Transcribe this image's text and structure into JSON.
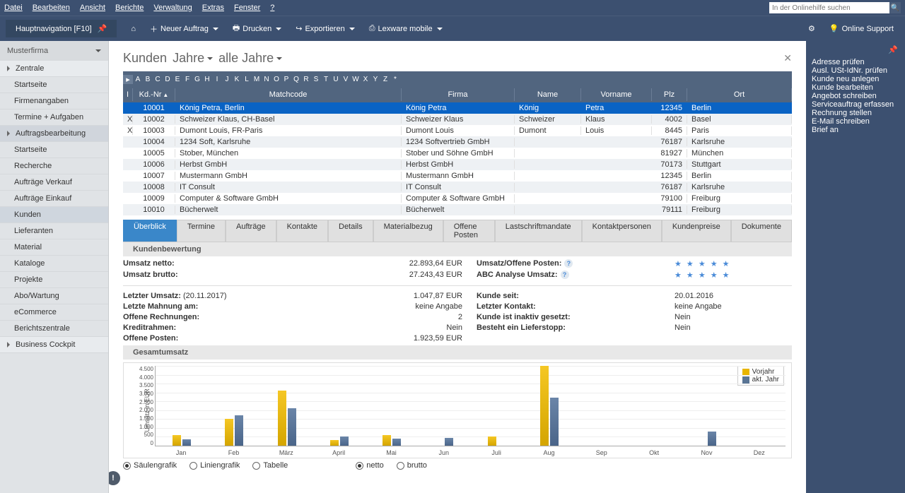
{
  "menubar": [
    "Datei",
    "Bearbeiten",
    "Ansicht",
    "Berichte",
    "Verwaltung",
    "Extras",
    "Fenster",
    "?"
  ],
  "search_placeholder": "In der Onlinehilfe suchen",
  "toolbar": {
    "nav": "Hauptnavigation [F10]",
    "new_order": "Neuer Auftrag",
    "print": "Drucken",
    "export": "Exportieren",
    "mobile": "Lexware mobile",
    "online_support": "Online Support"
  },
  "sidebar": {
    "header": "Musterfirma",
    "items": [
      {
        "label": "Zentrale",
        "level": 0
      },
      {
        "label": "Startseite",
        "level": 1
      },
      {
        "label": "Firmenangaben",
        "level": 1
      },
      {
        "label": "Termine + Aufgaben",
        "level": 1
      },
      {
        "label": "Auftragsbearbeitung",
        "level": 0,
        "active": true
      },
      {
        "label": "Startseite",
        "level": 1
      },
      {
        "label": "Recherche",
        "level": 1
      },
      {
        "label": "Aufträge Verkauf",
        "level": 1
      },
      {
        "label": "Aufträge Einkauf",
        "level": 1
      },
      {
        "label": "Kunden",
        "level": 1,
        "selected": true
      },
      {
        "label": "Lieferanten",
        "level": 1
      },
      {
        "label": "Material",
        "level": 1
      },
      {
        "label": "Kataloge",
        "level": 1
      },
      {
        "label": "Projekte",
        "level": 1
      },
      {
        "label": "Abo/Wartung",
        "level": 1
      },
      {
        "label": "eCommerce",
        "level": 1
      },
      {
        "label": "Berichtszentrale",
        "level": 1
      },
      {
        "label": "Business Cockpit",
        "level": 0
      }
    ]
  },
  "header": {
    "title": "Kunden",
    "dd1": "Jahre",
    "dd2": "alle Jahre"
  },
  "alpha": [
    "A",
    "B",
    "C",
    "D",
    "E",
    "F",
    "G",
    "H",
    "I",
    "J",
    "K",
    "L",
    "M",
    "N",
    "O",
    "P",
    "Q",
    "R",
    "S",
    "T",
    "U",
    "V",
    "W",
    "X",
    "Y",
    "Z",
    "*"
  ],
  "grid": {
    "cols": [
      "I",
      "Kd.-Nr",
      "Matchcode",
      "Firma",
      "Name",
      "Vorname",
      "Plz",
      "Ort"
    ],
    "rows": [
      {
        "x": "",
        "kdnr": "10001",
        "match": "König Petra, Berlin",
        "firma": "König Petra",
        "name": "König",
        "vor": "Petra",
        "plz": "12345",
        "ort": "Berlin",
        "selected": true
      },
      {
        "x": "X",
        "kdnr": "10002",
        "match": "Schweizer Klaus, CH-Basel",
        "firma": "Schweizer Klaus",
        "name": "Schweizer",
        "vor": "Klaus",
        "plz": "4002",
        "ort": "Basel"
      },
      {
        "x": "X",
        "kdnr": "10003",
        "match": "Dumont Louis, FR-Paris",
        "firma": "Dumont Louis",
        "name": "Dumont",
        "vor": "Louis",
        "plz": "8445",
        "ort": "Paris"
      },
      {
        "x": "",
        "kdnr": "10004",
        "match": "1234 Soft, Karlsruhe",
        "firma": "1234 Softvertrieb GmbH",
        "name": "",
        "vor": "",
        "plz": "76187",
        "ort": "Karlsruhe"
      },
      {
        "x": "",
        "kdnr": "10005",
        "match": "Stober, München",
        "firma": "Stober und Söhne GmbH",
        "name": "",
        "vor": "",
        "plz": "81927",
        "ort": "München"
      },
      {
        "x": "",
        "kdnr": "10006",
        "match": "Herbst GmbH",
        "firma": "Herbst GmbH",
        "name": "",
        "vor": "",
        "plz": "70173",
        "ort": "Stuttgart"
      },
      {
        "x": "",
        "kdnr": "10007",
        "match": "Mustermann GmbH",
        "firma": "Mustermann GmbH",
        "name": "",
        "vor": "",
        "plz": "12345",
        "ort": "Berlin"
      },
      {
        "x": "",
        "kdnr": "10008",
        "match": "IT Consult",
        "firma": "IT Consult",
        "name": "",
        "vor": "",
        "plz": "76187",
        "ort": "Karlsruhe"
      },
      {
        "x": "",
        "kdnr": "10009",
        "match": "Computer & Software GmbH",
        "firma": "Computer & Software GmbH",
        "name": "",
        "vor": "",
        "plz": "79100",
        "ort": "Freiburg"
      },
      {
        "x": "",
        "kdnr": "10010",
        "match": "Bücherwelt",
        "firma": "Bücherwelt",
        "name": "",
        "vor": "",
        "plz": "79111",
        "ort": "Freiburg"
      }
    ]
  },
  "tabs": [
    "Überblick",
    "Termine",
    "Aufträge",
    "Kontakte",
    "Details",
    "Materialbezug",
    "Offene Posten",
    "Lastschriftmandate",
    "Kontaktpersonen",
    "Kundenpreise",
    "Dokumente"
  ],
  "section1": "Kundenbewertung",
  "kv": {
    "umsatz_netto_l": "Umsatz netto:",
    "umsatz_netto_v": "22.893,64 EUR",
    "umsatz_brutto_l": "Umsatz brutto:",
    "umsatz_brutto_v": "27.243,43 EUR",
    "uop_l": "Umsatz/Offene Posten:",
    "uop_v": "★ ★ ★ ★ ★",
    "abc_l": "ABC Analyse Umsatz:",
    "abc_v": "★ ★ ★ ★ ★",
    "letzter_umsatz_l": "Letzter Umsatz:",
    "letzter_umsatz_d": "(20.11.2017)",
    "letzter_umsatz_v": "1.047,87 EUR",
    "kunde_seit_l": "Kunde seit:",
    "kunde_seit_v": "20.01.2016",
    "letzte_mahnung_l": "Letzte Mahnung am:",
    "letzte_mahnung_v": "keine Angabe",
    "letzter_kontakt_l": "Letzter Kontakt:",
    "letzter_kontakt_v": "keine Angabe",
    "offene_rech_l": "Offene Rechnungen:",
    "offene_rech_v": "2",
    "inaktiv_l": "Kunde ist inaktiv gesetzt:",
    "inaktiv_v": "Nein",
    "kredit_l": "Kreditrahmen:",
    "kredit_v": "Nein",
    "lieferstopp_l": "Besteht ein Lieferstopp:",
    "lieferstopp_v": "Nein",
    "offene_posten_l": "Offene Posten:",
    "offene_posten_v": "1.923,59 EUR"
  },
  "section2": "Gesamtumsatz",
  "chart_data": {
    "type": "bar",
    "ylabel": "Umsatz in EUR",
    "ylim": [
      0,
      4500
    ],
    "yticks": [
      0,
      500,
      1000,
      1500,
      2000,
      2500,
      3000,
      3500,
      4000,
      4500
    ],
    "categories": [
      "Jan",
      "Feb",
      "März",
      "April",
      "Mai",
      "Jun",
      "Juli",
      "Aug",
      "Sep",
      "Okt",
      "Nov",
      "Dez"
    ],
    "series": [
      {
        "name": "Vorjahr",
        "color": "#e8b500",
        "values": [
          600,
          1500,
          3100,
          300,
          600,
          0,
          500,
          4500,
          0,
          0,
          0,
          0
        ]
      },
      {
        "name": "akt. Jahr",
        "color": "#5a7595",
        "values": [
          350,
          1700,
          2100,
          500,
          400,
          450,
          0,
          2700,
          0,
          0,
          800,
          0
        ]
      }
    ]
  },
  "chart_opts": {
    "o1": "Säulengrafik",
    "o2": "Liniengrafik",
    "o3": "Tabelle",
    "o4": "netto",
    "o5": "brutto"
  },
  "rightbar": [
    "Adresse prüfen",
    "Ausl. USt-IdNr. prüfen",
    "Kunde neu anlegen",
    "Kunde bearbeiten",
    "Angebot schreiben",
    "Serviceauftrag erfassen",
    "Rechnung stellen",
    "E-Mail schreiben",
    "Brief an"
  ]
}
